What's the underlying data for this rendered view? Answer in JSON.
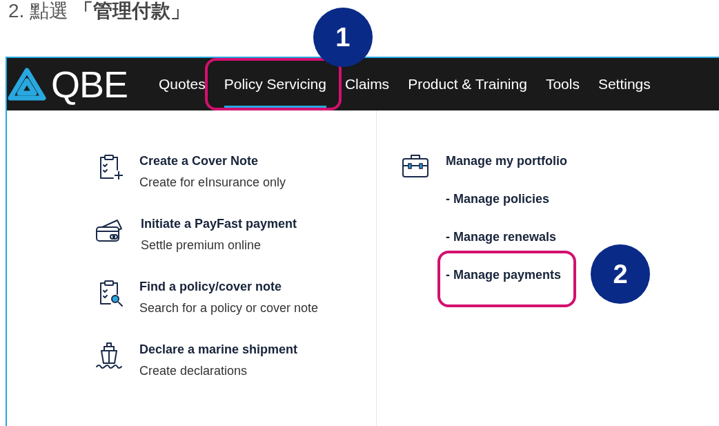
{
  "heading": "2. 點選 **「管理付款」**",
  "nav": {
    "logo": "QBE",
    "items": [
      {
        "label": "Quotes",
        "selected": false
      },
      {
        "label": "Policy Servicing",
        "selected": true,
        "highlighted": true,
        "badge": "1"
      },
      {
        "label": "Claims",
        "selected": false
      },
      {
        "label": "Product & Training",
        "selected": false
      },
      {
        "label": "Tools",
        "selected": false
      },
      {
        "label": "Settings",
        "selected": false
      }
    ]
  },
  "menu": {
    "left": [
      {
        "kind": "clipboard-plus",
        "title": "Create a Cover Note",
        "subtitle": "Create for eInsurance only"
      },
      {
        "kind": "cards",
        "title": "Initiate a PayFast payment",
        "subtitle": "Settle premium online"
      },
      {
        "kind": "clipboard-search",
        "title": "Find a policy/cover note",
        "subtitle": "Search for a policy or cover note"
      },
      {
        "kind": "ship",
        "title": "Declare a marine shipment",
        "subtitle": "Create declarations"
      }
    ],
    "right": {
      "title": "Manage my portfolio",
      "items": [
        {
          "label": "- Manage policies",
          "highlighted": false
        },
        {
          "label": "- Manage renewals",
          "highlighted": false
        },
        {
          "label": "- Manage payments",
          "highlighted": true,
          "badge": "2"
        }
      ]
    }
  }
}
